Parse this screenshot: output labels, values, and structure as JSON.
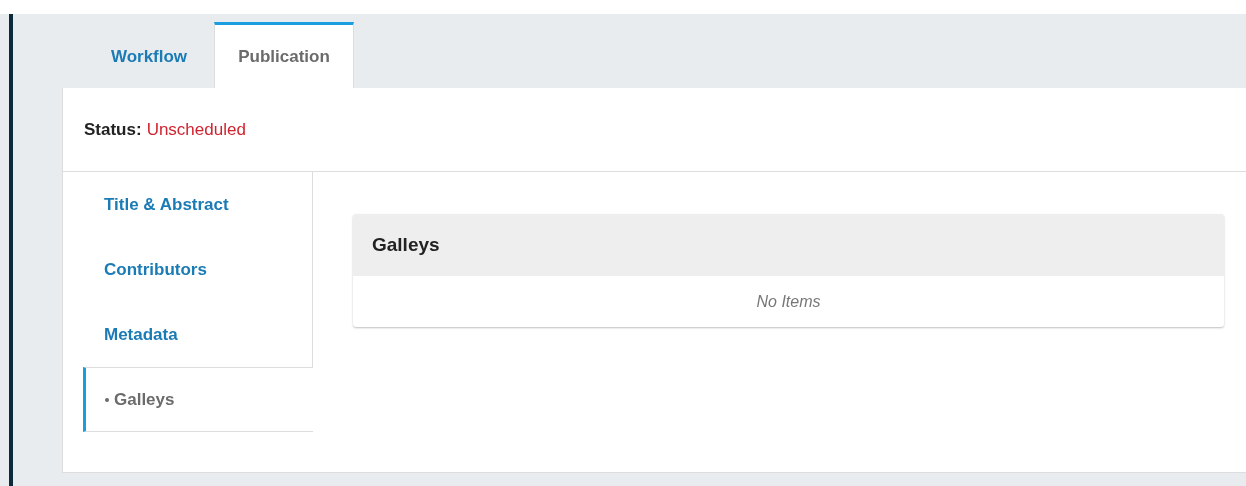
{
  "tabs": [
    {
      "label": "Workflow",
      "selected": false
    },
    {
      "label": "Publication",
      "selected": true
    }
  ],
  "status": {
    "label": "Status:",
    "value": "Unscheduled"
  },
  "side_nav": [
    {
      "label": "Title & Abstract",
      "selected": false
    },
    {
      "label": "Contributors",
      "selected": false
    },
    {
      "label": "Metadata",
      "selected": false
    },
    {
      "label": "Galleys",
      "selected": true
    }
  ],
  "galleys_panel": {
    "title": "Galleys",
    "empty_message": "No Items"
  }
}
